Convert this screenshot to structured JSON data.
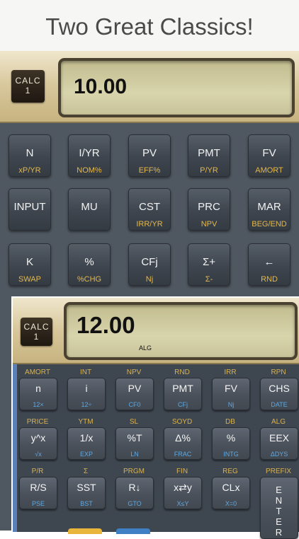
{
  "headline": "Two Great Classics!",
  "calc_back": {
    "logo": [
      "CALC",
      "1"
    ],
    "display": "10.00",
    "rows": [
      [
        {
          "main": "N",
          "sub": "xP/YR"
        },
        {
          "main": "I/YR",
          "sub": "NOM%"
        },
        {
          "main": "PV",
          "sub": "EFF%"
        },
        {
          "main": "PMT",
          "sub": "P/YR"
        },
        {
          "main": "FV",
          "sub": "AMORT"
        }
      ],
      [
        {
          "main": "INPUT",
          "sub": ""
        },
        {
          "main": "MU",
          "sub": ""
        },
        {
          "main": "CST",
          "sub": "IRR/YR"
        },
        {
          "main": "PRC",
          "sub": "NPV"
        },
        {
          "main": "MAR",
          "sub": "BEG/END"
        }
      ],
      [
        {
          "main": "K",
          "sub": "SWAP"
        },
        {
          "main": "%",
          "sub": "%CHG"
        },
        {
          "main": "CFj",
          "sub": "Nj"
        },
        {
          "main": "Σ+",
          "sub": "Σ-"
        },
        {
          "main": "←",
          "sub": "RND"
        }
      ]
    ]
  },
  "calc_front": {
    "logo": [
      "CALC",
      "1"
    ],
    "display": "12.00",
    "indicator": "ALG",
    "rows": [
      {
        "top": [
          "AMORT",
          "INT",
          "NPV",
          "RND",
          "IRR",
          "RPN"
        ],
        "keys": [
          {
            "main": "n",
            "sub": "12×"
          },
          {
            "main": "i",
            "sub": "12÷"
          },
          {
            "main": "PV",
            "sub": "CF0"
          },
          {
            "main": "PMT",
            "sub": "CFj"
          },
          {
            "main": "FV",
            "sub": "Nj"
          },
          {
            "main": "CHS",
            "sub": "DATE"
          }
        ]
      },
      {
        "top": [
          "PRICE",
          "YTM",
          "SL",
          "SOYD",
          "DB",
          "ALG"
        ],
        "keys": [
          {
            "main": "y^x",
            "sub": "√x"
          },
          {
            "main": "1/x",
            "sub": "EXP"
          },
          {
            "main": "%T",
            "sub": "LN"
          },
          {
            "main": "Δ%",
            "sub": "FRAC"
          },
          {
            "main": "%",
            "sub": "INTG"
          },
          {
            "main": "EEX",
            "sub": "ΔDYS"
          }
        ]
      },
      {
        "top": [
          "P/R",
          "Σ",
          "PRGM",
          "FIN",
          "REG",
          "PREFIX"
        ],
        "keys": [
          {
            "main": "R/S",
            "sub": "PSE"
          },
          {
            "main": "SST",
            "sub": "BST"
          },
          {
            "main": "R↓",
            "sub": "GTO"
          },
          {
            "main": "x⇄y",
            "sub": "X≤Y"
          },
          {
            "main": "CLx",
            "sub": "X=0"
          },
          {
            "main": "E\nN\nT\nE\nR",
            "sub": ""
          }
        ]
      }
    ]
  },
  "colors": {
    "gold_label": "#e4b84a",
    "blue_label": "#5fa8e0",
    "accent_yellow": "#e8b63a",
    "accent_blue": "#3f7fc4"
  }
}
